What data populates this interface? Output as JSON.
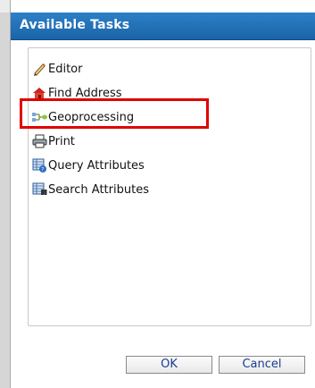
{
  "dialog": {
    "title": "Available Tasks"
  },
  "tasks": [
    {
      "label": "Editor",
      "icon": "pencil-icon"
    },
    {
      "label": "Find Address",
      "icon": "house-icon"
    },
    {
      "label": "Geoprocessing",
      "icon": "geoprocessing-icon"
    },
    {
      "label": "Print",
      "icon": "printer-icon"
    },
    {
      "label": "Query Attributes",
      "icon": "query-table-icon"
    },
    {
      "label": "Search Attributes",
      "icon": "search-table-icon"
    }
  ],
  "buttons": {
    "ok": "OK",
    "cancel": "Cancel"
  },
  "colors": {
    "title_bar": "#1e6fb6",
    "highlight": "#e10000"
  }
}
